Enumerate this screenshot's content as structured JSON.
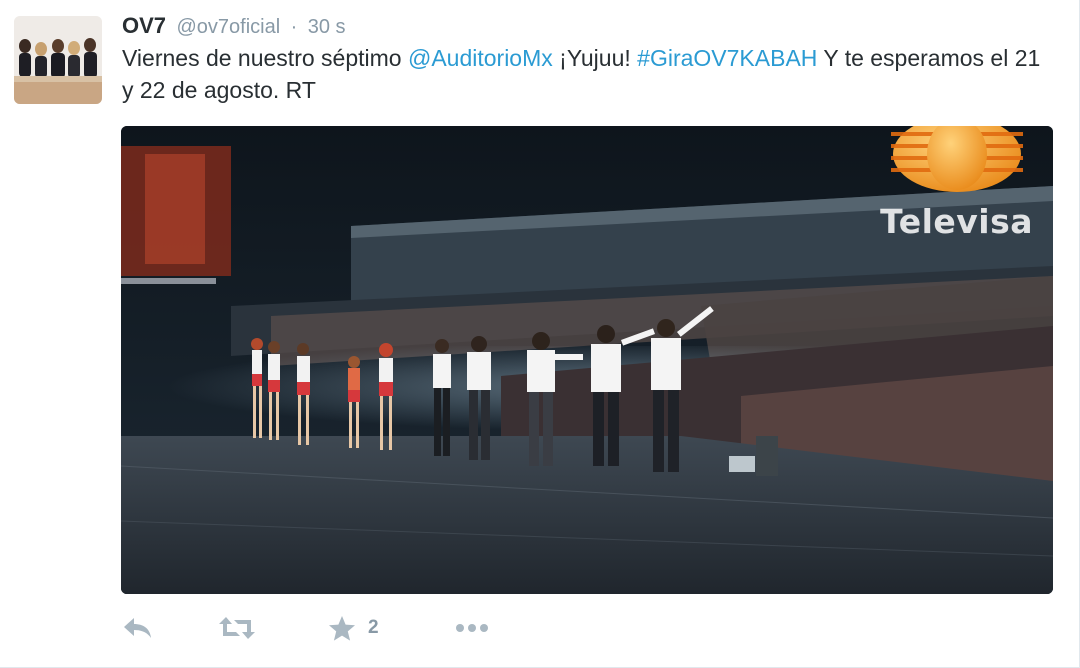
{
  "tweet": {
    "display_name": "OV7",
    "handle": "@ov7oficial",
    "separator": "·",
    "time": "30 s",
    "text_parts": [
      "Viernes de nuestro séptimo ",
      "@AuditorioMx",
      " ¡Yujuu! ",
      "#GiraOV7KABAH",
      " Y te esperamos el 21 y 22 de agosto. RT"
    ],
    "media": {
      "watermark": "Televisa"
    },
    "actions": {
      "reply_icon": "reply-icon",
      "retweet_icon": "retweet-icon",
      "favorite_icon": "star-icon",
      "favorite_count": "2",
      "more_icon": "more-icon"
    }
  },
  "colors": {
    "link": "#2b9bd3",
    "text": "#292f33",
    "muted": "#8899a6",
    "icon": "#aab8c2"
  }
}
